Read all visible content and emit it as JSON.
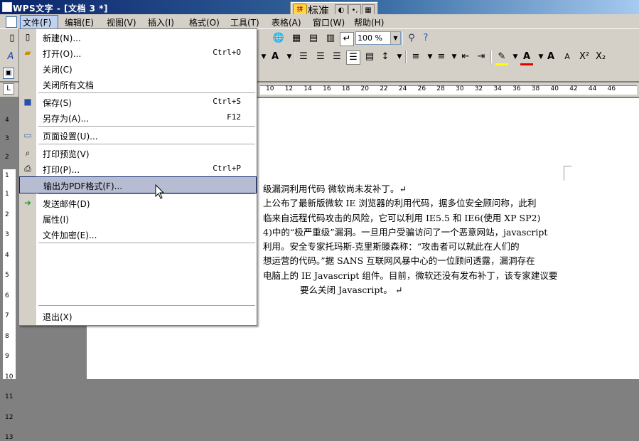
{
  "window": {
    "title": "WPS文字 - [文档 3 *]"
  },
  "ime": {
    "mode_label": "标准",
    "logo_text": "拼"
  },
  "menubar": {
    "items": [
      {
        "label": "文件(F)"
      },
      {
        "label": "编辑(E)"
      },
      {
        "label": "视图(V)"
      },
      {
        "label": "插入(I)"
      },
      {
        "label": "格式(O)"
      },
      {
        "label": "工具(T)"
      },
      {
        "label": "表格(A)"
      },
      {
        "label": "窗口(W)"
      },
      {
        "label": "帮助(H)"
      }
    ]
  },
  "toolbar": {
    "zoom_value": "100 %"
  },
  "file_menu": {
    "items": [
      {
        "label": "新建(N)...",
        "shortcut": ""
      },
      {
        "label": "打开(O)...",
        "shortcut": "Ctrl+O"
      },
      {
        "label": "关闭(C)",
        "shortcut": ""
      },
      {
        "label": "关闭所有文档",
        "shortcut": ""
      },
      {
        "label": "保存(S)",
        "shortcut": "Ctrl+S"
      },
      {
        "label": "另存为(A)...",
        "shortcut": "F12"
      },
      {
        "label": "页面设置(U)...",
        "shortcut": ""
      },
      {
        "label": "打印预览(V)",
        "shortcut": ""
      },
      {
        "label": "打印(P)...",
        "shortcut": "Ctrl+P"
      },
      {
        "label": "输出为PDF格式(F)...",
        "shortcut": ""
      },
      {
        "label": "发送邮件(D)",
        "shortcut": ""
      },
      {
        "label": "属性(I)",
        "shortcut": ""
      },
      {
        "label": "文件加密(E)...",
        "shortcut": ""
      },
      {
        "label": "退出(X)",
        "shortcut": ""
      }
    ],
    "highlighted": "输出为PDF格式(F)..."
  },
  "ruler": {
    "h_ticks": [
      "10",
      "12",
      "14",
      "16",
      "18",
      "20",
      "22",
      "24",
      "26",
      "28",
      "30",
      "32",
      "34",
      "36",
      "38",
      "40",
      "42",
      "44",
      "46"
    ],
    "v_ticks_top": [
      "4",
      "3",
      "2",
      "1"
    ],
    "v_ticks": [
      "1",
      "2",
      "3",
      "4",
      "5",
      "6",
      "7",
      "8",
      "9",
      "10",
      "11",
      "12",
      "13"
    ]
  },
  "document": {
    "lines": [
      "级漏洞利用代码 微软尚未发补丁。↵",
      "上公布了最新版微软 IE 浏览器的利用代码，据多位安全顾问称，此利",
      "临来自远程代码攻击的风险，它可以利用 IE5.5 和 IE6(使用 XP SP2)",
      "4)中的“极严重级”漏洞。一旦用户受骗访问了一个恶意网站，javascript",
      "利用。安全专家托玛斯-克里斯滕森称：“攻击者可以就此在人们的",
      "想运营的代码。”据 SANS 互联网风暴中心的一位顾问透露，漏洞存在",
      "电脑上的 IE Javascript 组件。目前，微软还没有发布补丁，该专家建议要",
      "要么关闭 Javascript。 ↵"
    ]
  }
}
